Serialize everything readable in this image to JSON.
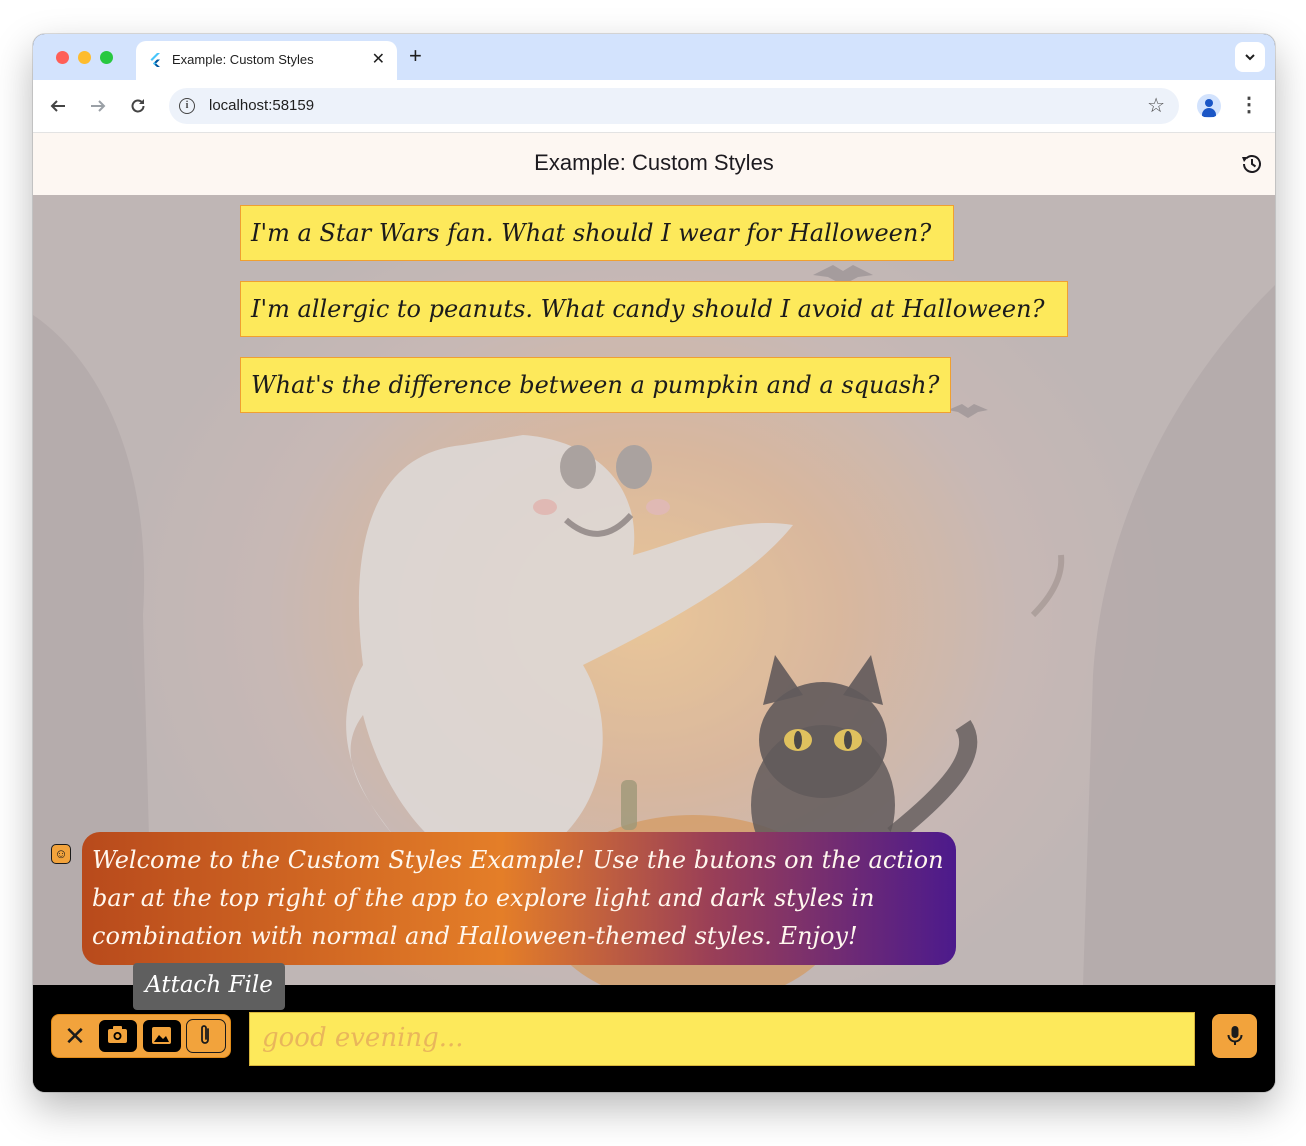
{
  "browser": {
    "tab_title": "Example: Custom Styles",
    "tab_close": "✕",
    "new_tab": "+",
    "url": "localhost:58159",
    "icons": [
      "back-icon",
      "forward-icon",
      "reload-icon",
      "site-info-icon",
      "bookmark-star-icon",
      "profile-icon",
      "menu-icon",
      "tab-search-icon"
    ]
  },
  "app": {
    "title": "Example: Custom Styles",
    "history_icon": "history-icon"
  },
  "suggestions": [
    "I'm a Star Wars fan. What should I wear for Halloween?",
    "I'm allergic to peanuts. What candy should I avoid at Halloween?",
    "What's the difference between a pumpkin and a squash?"
  ],
  "messages": [
    {
      "role": "llm",
      "text": "Welcome to the Custom Styles Example! Use the butons on the action bar at the top right of the app to explore light and dark styles in combination with normal and Halloween-themed styles. Enjoy!"
    }
  ],
  "tooltip": "Attach File",
  "input": {
    "placeholder": "good evening...",
    "close_symbol": "✕",
    "actions": [
      "camera-icon",
      "gallery-icon",
      "attach-file-icon"
    ],
    "submit_icon": "mic-icon"
  },
  "colors": {
    "suggestion_bg": "#fde95b",
    "accent_orange": "#f2a33c",
    "bubble_gradient": [
      "#b84a1c",
      "#e47e28",
      "#4c1a8c"
    ],
    "browser_chrome": "#d3e3fd"
  }
}
